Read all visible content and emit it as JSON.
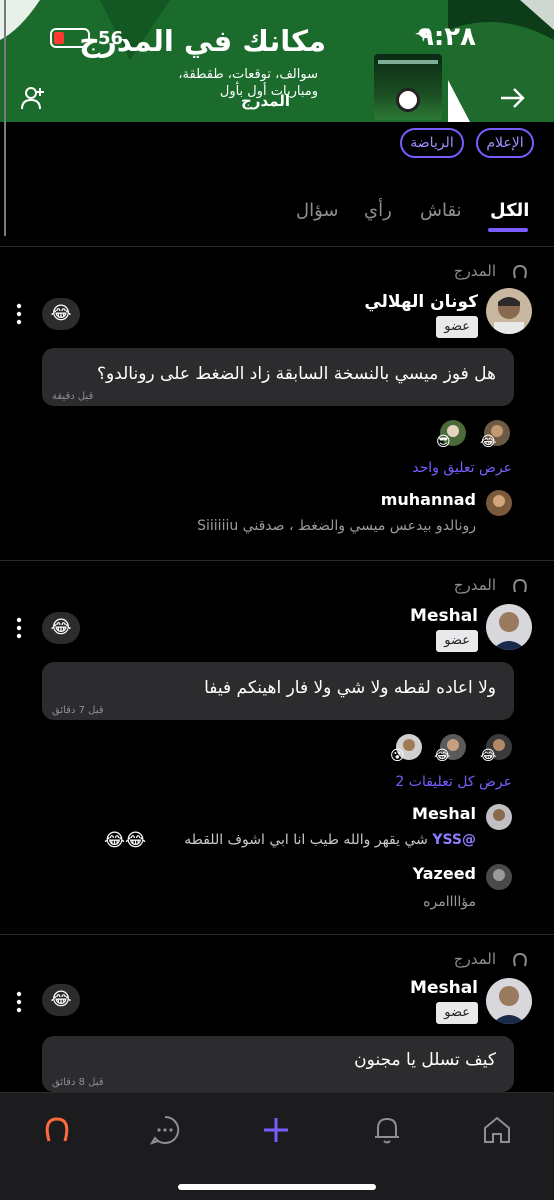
{
  "status_bar": {
    "time": "٩:٢٨",
    "battery": "56"
  },
  "header": {
    "title": "مكانك في المدرج",
    "description": "سوالف، توقعات، طقطقة، ومباريات أول بأول",
    "group_name": "المدرج"
  },
  "tags": [
    "الإعلام",
    "الرياضة"
  ],
  "tabs": [
    {
      "label": "الكل",
      "active": true
    },
    {
      "label": "نقاش",
      "active": false
    },
    {
      "label": "رأي",
      "active": false
    },
    {
      "label": "سؤال",
      "active": false
    }
  ],
  "member_badge": "عضو",
  "reaction_emoji": "😂",
  "posts": [
    {
      "source": "المدرج",
      "author": "كونان الهلالي",
      "text": "هل فوز ميسي بالنسخة السابقة زاد الضغط على رونالدو؟",
      "time": "قبل دقيقة",
      "view_comments": "عرض تعليق واحد",
      "comments": [
        {
          "author": "muhannad",
          "text": "رونالدو بيدعس ميسي والضغط ، صدقني Siiiiiiu"
        }
      ]
    },
    {
      "source": "المدرج",
      "author": "Meshal",
      "text": "ولا اعاده لقطه ولا شي ولا فار اهينكم فيفا",
      "time": "قبل 7 دقائق",
      "view_comments": "عرض كل تعليقات 2",
      "comments": [
        {
          "author": "Meshal",
          "mention": "@YSS",
          "text": "شي يقهر والله طيب انا ابي اشوف اللقطه",
          "emojis": "😂😂"
        },
        {
          "author": "Yazeed",
          "text": "مؤاااامره"
        }
      ]
    },
    {
      "source": "المدرج",
      "author": "Meshal",
      "text": "كيف تسلل يا مجنون",
      "time": "قبل 8 دقائق"
    }
  ],
  "bottom_nav": [
    "horseshoe-icon",
    "chat-icon",
    "plus-icon",
    "bell-icon",
    "home-icon"
  ],
  "colors": {
    "accent": "#7b5cff",
    "header_green": "#1b6b2c",
    "background": "#000000",
    "bubble": "#2c2c2e"
  }
}
